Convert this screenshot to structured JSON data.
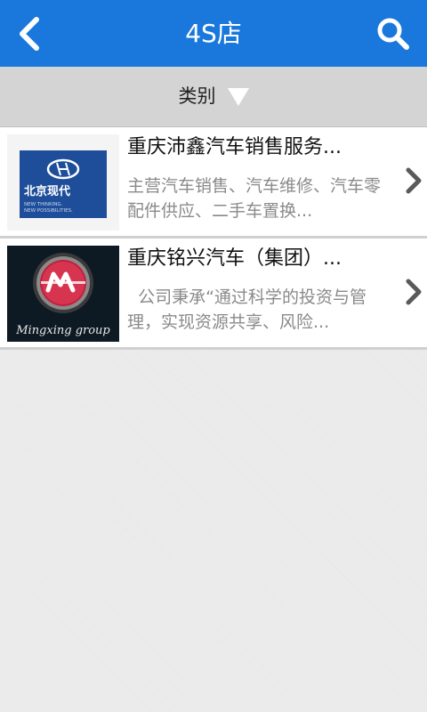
{
  "header": {
    "title": "4S店",
    "back_icon": "chevron-left-icon",
    "search_icon": "search-icon",
    "bg_color": "#1a78dc"
  },
  "filter": {
    "label": "类别",
    "arrow_icon": "triangle-down-icon"
  },
  "items": [
    {
      "title": "重庆沛鑫汽车销售服务...",
      "description": "主营汽车销售、汽车维修、汽车零配件供应、二手车置换...",
      "logo_text": "北京现代",
      "logo_tagline_1": "NEW THINKING.",
      "logo_tagline_2": "NEW POSSIBILITIES."
    },
    {
      "title": "重庆铭兴汽车（集团）...",
      "description": "  公司秉承“通过科学的投资与管理，实现资源共享、风险...",
      "logo_text": "Mingxing group"
    }
  ]
}
